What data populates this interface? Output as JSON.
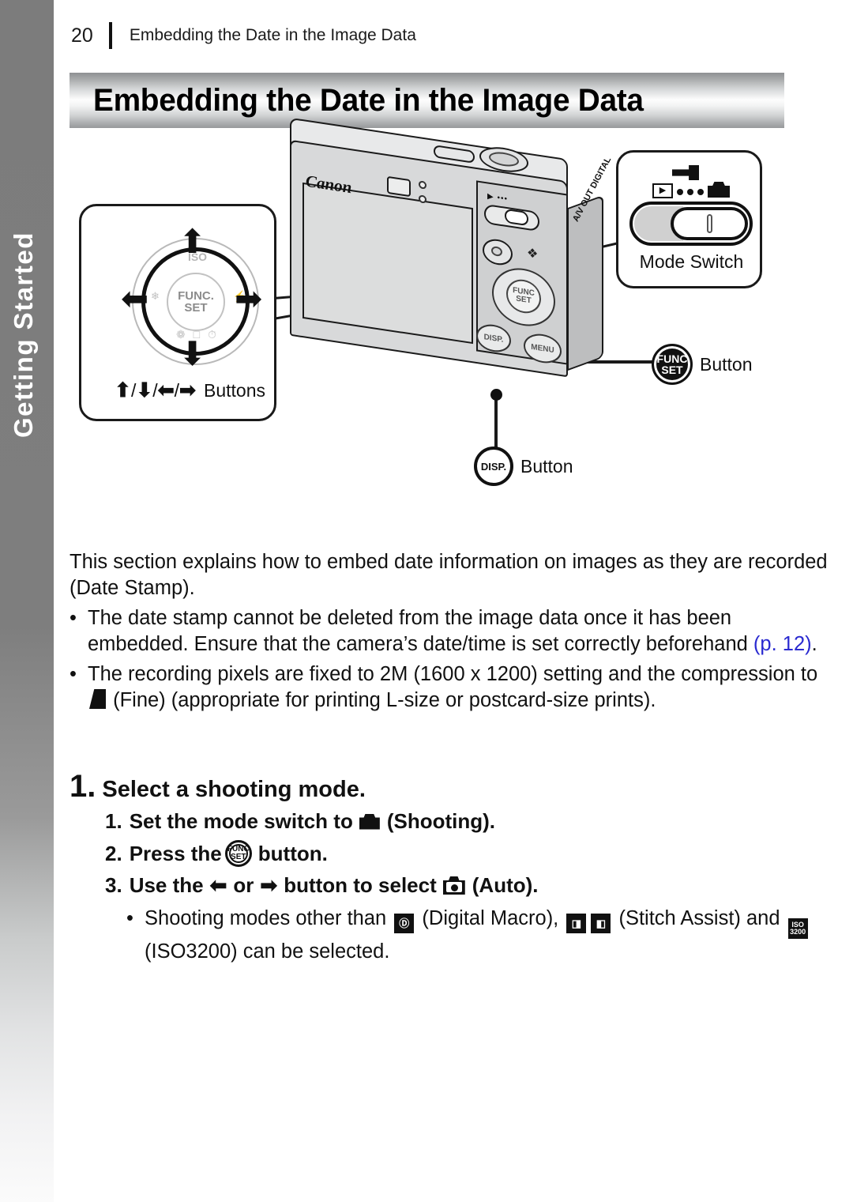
{
  "header": {
    "page_number": "20",
    "running_title": "Embedding the Date in the Image Data"
  },
  "sidebar": {
    "tab_label": "Getting Started"
  },
  "title_bar": {
    "title": "Embedding the Date in the Image Data"
  },
  "figure": {
    "callout_buttons": {
      "label_prefix": "/",
      "label": "Buttons",
      "arrows": [
        "⬆",
        "⬇",
        "⬅",
        "➡"
      ],
      "dpad_center_line1": "FUNC.",
      "dpad_center_line2": "SET",
      "dpad_top_label": "ISO",
      "dpad_bottom_icons": "❁ □ ⏱"
    },
    "callout_mode": {
      "label": "Mode Switch",
      "play_glyph": "▶"
    },
    "func_button": {
      "icon_line1": "FUNC",
      "icon_line2": "SET",
      "label": "Button"
    },
    "disp_button": {
      "icon_text": "DISP.",
      "label": "Button"
    },
    "camera": {
      "brand": "Canon",
      "side_port_label": "A/V OUT DIGITAL",
      "dial_line1": "FUNC",
      "dial_line2": "SET",
      "disp_text": "DISP.",
      "menu_text": "MENU",
      "mode_icons": "▶ •••"
    }
  },
  "body": {
    "intro": "This section explains how to embed date information on images as they are recorded (Date Stamp).",
    "bullet1_part1": "The date stamp cannot be deleted from the image data once it has been embedded. Ensure that the camera’s date/time is set correctly beforehand ",
    "bullet1_link": "(p. 12)",
    "bullet1_part2": ".",
    "bullet2_part1": "The recording pixels are fixed to 2M (1600 x 1200) setting and the compression to ",
    "bullet2_part2": " (Fine) (appropriate for printing L-size or postcard-size prints).",
    "bullet_mark": "•"
  },
  "steps": {
    "step1_number": "1.",
    "step1_title": "Select a shooting mode.",
    "sub1_number": "1.",
    "sub1_text_a": "Set the mode switch to",
    "sub1_text_b": "(Shooting).",
    "sub2_number": "2.",
    "sub2_text_a": "Press the",
    "sub2_text_b": "button.",
    "sub2_icon_line1": "FUNC",
    "sub2_icon_line2": "SET",
    "sub3_number": "3.",
    "sub3_text_a": "Use the",
    "sub3_arrow_left": "⬅",
    "sub3_text_or": "or",
    "sub3_arrow_right": "➡",
    "sub3_text_b": "button to select",
    "sub3_text_c": "(Auto).",
    "note_bullet": "•",
    "note_part1": "Shooting modes other than",
    "note_macro_icon": "Ⓓ",
    "note_part2": "(Digital Macro),",
    "note_stitch_icon_1": "◨",
    "note_stitch_icon_2": "◧",
    "note_part3": "(Stitch Assist) and",
    "note_iso_line1": "ISO",
    "note_iso_line2": "3200",
    "note_part4": "(ISO3200) can be selected."
  },
  "colors": {
    "sidebar_gray": "#7c7c7c",
    "link_blue": "#2a2ad0",
    "ink": "#111111"
  }
}
